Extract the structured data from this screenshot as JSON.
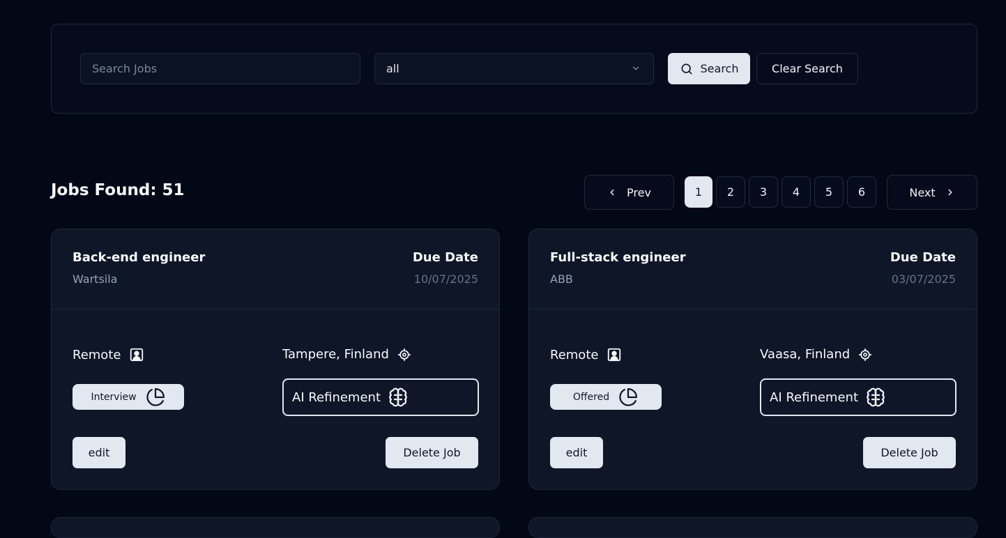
{
  "search": {
    "placeholder": "Search Jobs",
    "filter_value": "all",
    "search_label": "Search",
    "clear_label": "Clear Search"
  },
  "results": {
    "jobs_found": "Jobs Found: 51"
  },
  "pagination": {
    "prev_label": "Prev",
    "next_label": "Next",
    "pages": [
      "1",
      "2",
      "3",
      "4",
      "5",
      "6"
    ],
    "current_page": "1"
  },
  "jobs": [
    {
      "title": "Back-end engineer",
      "company": "Wartsila",
      "due_label": "Due Date",
      "due_date": "10/07/2025",
      "work_type": "Remote",
      "location": "Tampere, Finland",
      "status": "Interview",
      "ai_label": "AI Refinement",
      "edit_label": "edit",
      "delete_label": "Delete Job"
    },
    {
      "title": "Full-stack engineer",
      "company": "ABB",
      "due_label": "Due Date",
      "due_date": "03/07/2025",
      "work_type": "Remote",
      "location": "Vaasa, Finland",
      "status": "Offered",
      "ai_label": "AI Refinement",
      "edit_label": "edit",
      "delete_label": "Delete Job"
    }
  ],
  "icons": {
    "search": "search-icon",
    "chevron": "chevron-down-icon",
    "prev": "chevron-left-icon",
    "next": "chevron-right-icon",
    "remote": "user-square-icon",
    "location": "crosshair-icon",
    "status": "pie-chart-icon",
    "ai": "brain-icon"
  },
  "colors": {
    "background": "#030817",
    "card": "#0e1628",
    "border": "#1e293b",
    "light_button": "#e2e8f0",
    "muted_text": "#94a3b8"
  }
}
